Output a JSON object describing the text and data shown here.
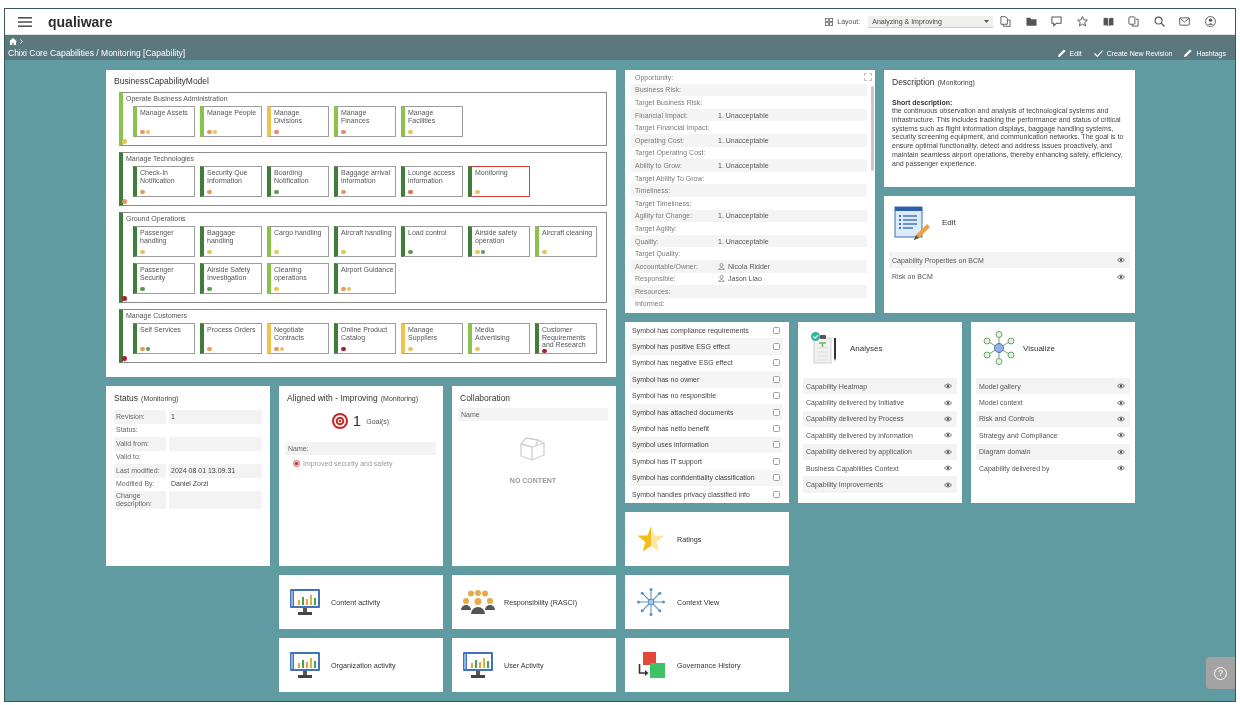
{
  "header": {
    "logo": "qualiware",
    "layout_label": "Layout:",
    "layout_value": "Analyzing & Improving"
  },
  "breadcrumb": {
    "title": "Chixi Core Capabilities / Monitoring [Capability]",
    "actions": [
      {
        "kind": "pencil",
        "label": "Edit"
      },
      {
        "kind": "check",
        "label": "Create New Revision"
      },
      {
        "kind": "pencil",
        "label": "Hashtags"
      }
    ]
  },
  "bcm": {
    "title": "BusinessCapabilityModel",
    "groups": [
      {
        "label": "Operate Business Administration",
        "color": "#8bc34a",
        "dots": [
          {
            "color": "#e8c25a"
          }
        ],
        "items": [
          {
            "label": "Manage Assets",
            "color": "#8bc34a",
            "selected": false,
            "dots": [
              {
                "color": "#e59a5c"
              },
              {
                "color": "#e8c25a"
              }
            ]
          },
          {
            "label": "Manage People",
            "color": "#8bc34a",
            "selected": false,
            "dots": [
              {
                "color": "#e59a5c"
              },
              {
                "color": "#e8c25a"
              }
            ]
          },
          {
            "label": "Manage Divisions",
            "color": "#f2c14e",
            "selected": false,
            "dots": [
              {
                "color": "#e08a6e"
              }
            ]
          },
          {
            "label": "Manage Finances",
            "color": "#8bc34a",
            "selected": false,
            "dots": [
              {
                "color": "#e08a6e"
              }
            ]
          },
          {
            "label": "Manage Facilities",
            "color": "#8bc34a",
            "selected": false,
            "dots": [
              {
                "color": "#e8c25a"
              }
            ]
          }
        ]
      },
      {
        "label": "Manage Technologies",
        "color": "#3f7d3a",
        "dots": [
          {
            "color": "#e59a5c"
          }
        ],
        "items": [
          {
            "label": "Check-In Notification",
            "color": "#3f7d3a",
            "selected": false,
            "dots": [
              {
                "color": "#e59a5c"
              }
            ]
          },
          {
            "label": "Security Que Information",
            "color": "#3f7d3a",
            "selected": false,
            "dots": [
              {
                "color": "#e59a5c"
              }
            ]
          },
          {
            "label": "Boarding Notification",
            "color": "#3f7d3a",
            "selected": false,
            "dots": [
              {
                "color": "#5c9a50"
              }
            ]
          },
          {
            "label": "Baggage arrival information",
            "color": "#3f7d3a",
            "selected": false,
            "dots": [
              {
                "color": "#e59a5c"
              }
            ]
          },
          {
            "label": "Lounge access information",
            "color": "#3f7d3a",
            "selected": false,
            "dots": [
              {
                "color": "#e07050"
              }
            ]
          },
          {
            "label": "Monitoring",
            "color": "#3f7d3a",
            "selected": true,
            "dots": [
              {
                "color": "#e8c25a"
              }
            ]
          }
        ]
      },
      {
        "label": "Ground Operations",
        "color": "#3f7d3a",
        "dots": [
          {
            "color": "#a8202c"
          }
        ],
        "items": [
          {
            "label": "Passenger handling",
            "color": "#3f7d3a",
            "selected": false,
            "dots": [
              {
                "color": "#e8c25a"
              }
            ]
          },
          {
            "label": "Baggage handling",
            "color": "#3f7d3a",
            "selected": false,
            "dots": [
              {
                "color": "#e8c25a"
              }
            ]
          },
          {
            "label": "Cargo handling",
            "color": "#8bc34a",
            "selected": false,
            "dots": [
              {
                "color": "#e8c25a"
              }
            ]
          },
          {
            "label": "Aircraft handling",
            "color": "#3f7d3a",
            "selected": false,
            "dots": [
              {
                "color": "#e8c25a"
              }
            ]
          },
          {
            "label": "Load control",
            "color": "#3f7d3a",
            "selected": false,
            "dots": [
              {
                "color": "#5c9a50"
              }
            ]
          },
          {
            "label": "Airside safety operation",
            "color": "#3f7d3a",
            "selected": false,
            "dots": [
              {
                "color": "#e8c25a"
              },
              {
                "color": "#5c9a50"
              }
            ]
          },
          {
            "label": "Aircraft cleaning",
            "color": "#8bc34a",
            "selected": false,
            "dots": [
              {
                "color": "#e8c25a"
              }
            ]
          },
          {
            "label": "Passenger Security",
            "color": "#3f7d3a",
            "selected": false,
            "dots": [
              {
                "color": "#5c9a50"
              }
            ]
          },
          {
            "label": "Airside Safety Investigation",
            "color": "#3f7d3a",
            "selected": false,
            "dots": [
              {
                "color": "#5c9a50"
              }
            ]
          },
          {
            "label": "Cleaning operations",
            "color": "#8bc34a",
            "selected": false,
            "dots": [
              {
                "color": "#e8c25a"
              }
            ]
          },
          {
            "label": "Airport Guidance",
            "color": "#3f7d3a",
            "selected": false,
            "dots": [
              {
                "color": "#e59a5c"
              },
              {
                "color": "#e8c25a"
              }
            ]
          }
        ]
      },
      {
        "label": "Manage Customers",
        "color": "#3f7d3a",
        "dots": [
          {
            "color": "#a8202c"
          }
        ],
        "items": [
          {
            "label": "Self Services",
            "color": "#3f7d3a",
            "selected": false,
            "dots": [
              {
                "color": "#e59a5c"
              },
              {
                "color": "#5c9a50"
              }
            ]
          },
          {
            "label": "Process Orders",
            "color": "#3f7d3a",
            "selected": false,
            "dots": [
              {
                "color": "#e59a5c"
              }
            ]
          },
          {
            "label": "Negotiate Contracts",
            "color": "#f2c14e",
            "selected": false,
            "dots": [
              {
                "color": "#e59a5c"
              },
              {
                "color": "#e8c25a"
              }
            ]
          },
          {
            "label": "Online Product Catalog",
            "color": "#3f7d3a",
            "selected": false,
            "dots": [
              {
                "color": "#a8202c"
              }
            ]
          },
          {
            "label": "Manage Suppliers",
            "color": "#f2c14e",
            "selected": false,
            "dots": [
              {
                "color": "#e8c25a"
              }
            ]
          },
          {
            "label": "Media Advertising",
            "color": "#8bc34a",
            "selected": false,
            "dots": [
              {
                "color": "#e8c25a"
              }
            ]
          },
          {
            "label": "Customer Requirements and Research",
            "color": "#3f7d3a",
            "selected": false,
            "dots": [
              {
                "color": "#a8202c"
              }
            ]
          }
        ]
      }
    ]
  },
  "properties": {
    "rows": [
      {
        "kind": "text",
        "label": "Opportunity:"
      },
      {
        "kind": "text",
        "label": "Business Risk:"
      },
      {
        "kind": "text",
        "label": "Target Business Risk:"
      },
      {
        "kind": "text",
        "label": "Financial Impact:",
        "value": "1. Unacceptable"
      },
      {
        "kind": "text",
        "label": "Target Financial Impact:"
      },
      {
        "kind": "text",
        "label": "Operating Cost:",
        "value": "1. Unacceptable"
      },
      {
        "kind": "text",
        "label": "Target Operating Cost:"
      },
      {
        "kind": "text",
        "label": "Ability to Grow:",
        "value": "1. Unacceptable"
      },
      {
        "kind": "text",
        "label": "Target Ability To Grow:"
      },
      {
        "kind": "text",
        "label": "Timeliness:"
      },
      {
        "kind": "text",
        "label": "Target Timeliness:"
      },
      {
        "kind": "text",
        "label": "Agility for Change:",
        "value": "1. Unacceptable"
      },
      {
        "kind": "text",
        "label": "Target Agility:"
      },
      {
        "kind": "text",
        "label": "Quality:",
        "value": "1. Unacceptable"
      },
      {
        "kind": "text",
        "label": "Target Quality:"
      },
      {
        "kind": "person",
        "label": "Accountable/Owner:",
        "value": "Nicola Ridder"
      },
      {
        "kind": "person",
        "label": "Responsible:",
        "value": "Jason Liao"
      },
      {
        "kind": "text",
        "label": "Resources:"
      },
      {
        "kind": "text",
        "label": "Informed:"
      }
    ]
  },
  "description": {
    "title": "Description",
    "context": "(Monitoring)",
    "label": "Short description:",
    "text": "the continuous observation and analysis of technological systems and infrastructure. This includes tracking the performance and status of critical systems such as flight information displays, baggage handling systems, security screening equipment, and communication networks. The goal is to ensure optimal functionality, detect and address issues proactively, and maintain seamless airport operations, thereby enhancing safety, efficiency, and passenger experience."
  },
  "edit_panel": {
    "kind": "edit",
    "title": "Edit",
    "items": [
      {
        "label": "Capability Properties on BCM"
      },
      {
        "label": "Risk on BCM"
      }
    ]
  },
  "filters": [
    {
      "label": "Symbol has compliance requirements",
      "checked": false
    },
    {
      "label": "Symbol has positive ESG effect",
      "checked": false
    },
    {
      "label": "Symbol has negative ESG effect",
      "checked": false
    },
    {
      "label": "Symbol has no owner",
      "checked": false
    },
    {
      "label": "Symbol has no responsible",
      "checked": false
    },
    {
      "label": "Symbol has attached documents",
      "checked": false
    },
    {
      "label": "Symbol has netto benefit",
      "checked": false
    },
    {
      "label": "Symbol uses information",
      "checked": false
    },
    {
      "label": "Symbol has IT support",
      "checked": false
    },
    {
      "label": "Symbol has confidentiality classification",
      "checked": false
    },
    {
      "label": "Symbol handles privacy classified info",
      "checked": false
    }
  ],
  "analyses": {
    "kind": "analyses",
    "title": "Analyses",
    "items": [
      {
        "label": "Capability Heatmap"
      },
      {
        "label": "Capability delivered by Initiative"
      },
      {
        "label": "Capability delivered by Process"
      },
      {
        "label": "Capability delivered by information"
      },
      {
        "label": "Capability delivered by application"
      },
      {
        "label": "Business Capabilities Context"
      },
      {
        "label": "Capability Improvements"
      }
    ]
  },
  "visualize": {
    "kind": "visualize",
    "title": "Visualize",
    "items": [
      {
        "label": "Model gallery"
      },
      {
        "label": "Model context"
      },
      {
        "label": "Risk and Controls"
      },
      {
        "label": "Strategy and Compliance"
      },
      {
        "label": "Diagram domain"
      },
      {
        "label": "Capability delivered by"
      }
    ]
  },
  "status": {
    "title": "Status",
    "context": "(Monitoring)",
    "rows": [
      {
        "label": "Revision:",
        "value": "1"
      },
      {
        "label": "Status:"
      },
      {
        "label": "Valid from:"
      },
      {
        "label": "Valid to:"
      },
      {
        "label": "Last modified:",
        "value": "2024 08 01 13.09.31"
      },
      {
        "label": "Modified By:",
        "value": "Daniel Zorzi"
      },
      {
        "label": "Change description:"
      }
    ]
  },
  "aligned": {
    "title": "Aligned with - Improving",
    "context": "(Monitoring)",
    "count": "1",
    "count_label": "Goal(s)",
    "column": "Name:",
    "goals": [
      {
        "label": "Improved security and safety"
      }
    ]
  },
  "collaboration": {
    "title": "Collaboration",
    "column": "Name",
    "empty_text": "NO CONTENT"
  },
  "tiles": [
    {
      "kind": "ratings",
      "label": "Ratings"
    },
    {
      "kind": "activity",
      "label": "Content activity"
    },
    {
      "kind": "people",
      "label": "Responsibility (RASCI)"
    },
    {
      "kind": "network",
      "label": "Context View"
    },
    {
      "kind": "activity",
      "label": "Organization activity"
    },
    {
      "kind": "activity",
      "label": "User Activity"
    },
    {
      "kind": "history",
      "label": "Governance History"
    }
  ],
  "help": {
    "label": "?"
  }
}
